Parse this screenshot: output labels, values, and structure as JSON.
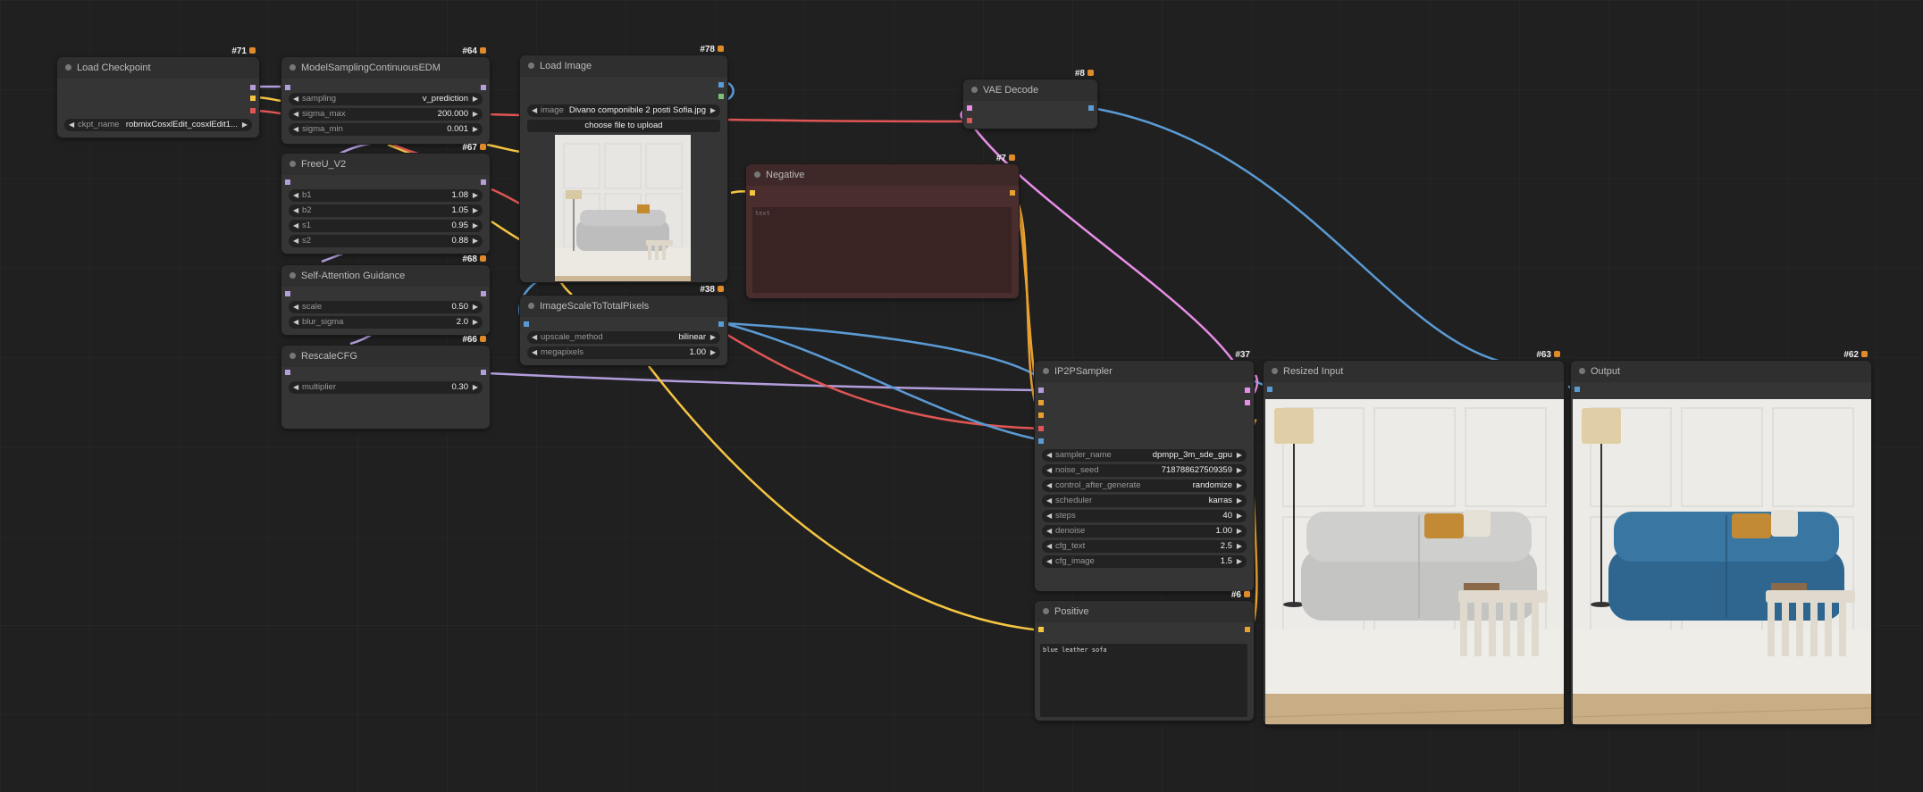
{
  "canvas": {
    "nodes": {
      "load_checkpoint": {
        "id": "#71",
        "title": "Load Checkpoint",
        "widgets": [
          {
            "label": "ckpt_name",
            "value": "robmixCosxlEdit_cosxlEdit1..."
          }
        ]
      },
      "model_sampling": {
        "id": "#64",
        "title": "ModelSamplingContinuousEDM",
        "widgets": [
          {
            "label": "sampling",
            "value": "v_prediction"
          },
          {
            "label": "sigma_max",
            "value": "200.000"
          },
          {
            "label": "sigma_min",
            "value": "0.001"
          }
        ]
      },
      "freeu": {
        "id": "#67",
        "title": "FreeU_V2",
        "widgets": [
          {
            "label": "b1",
            "value": "1.08"
          },
          {
            "label": "b2",
            "value": "1.05"
          },
          {
            "label": "s1",
            "value": "0.95"
          },
          {
            "label": "s2",
            "value": "0.88"
          }
        ]
      },
      "self_attention": {
        "id": "#68",
        "title": "Self-Attention Guidance",
        "widgets": [
          {
            "label": "scale",
            "value": "0.50"
          },
          {
            "label": "blur_sigma",
            "value": "2.0"
          }
        ]
      },
      "rescale_cfg": {
        "id": "#66",
        "title": "RescaleCFG",
        "widgets": [
          {
            "label": "multiplier",
            "value": "0.30"
          }
        ]
      },
      "load_image": {
        "id": "#78",
        "title": "Load Image",
        "widgets": [
          {
            "label": "image",
            "value": "Divano componibile 2 posti Sofia.jpg"
          }
        ],
        "upload_label": "choose file to upload"
      },
      "image_scale": {
        "id": "#38",
        "title": "ImageScaleToTotalPixels",
        "widgets": [
          {
            "label": "upscale_method",
            "value": "bilinear"
          },
          {
            "label": "megapixels",
            "value": "1.00"
          }
        ]
      },
      "negative": {
        "id": "#7",
        "title": "Negative",
        "text": "text"
      },
      "vae_decode": {
        "id": "#8",
        "title": "VAE Decode"
      },
      "ip2p_sampler": {
        "id": "#37",
        "title": "IP2PSampler",
        "widgets": [
          {
            "label": "sampler_name",
            "value": "dpmpp_3m_sde_gpu"
          },
          {
            "label": "noise_seed",
            "value": "718788627509359"
          },
          {
            "label": "control_after_generate",
            "value": "randomize"
          },
          {
            "label": "scheduler",
            "value": "karras"
          },
          {
            "label": "steps",
            "value": "40"
          },
          {
            "label": "denoise",
            "value": "1.00"
          },
          {
            "label": "cfg_text",
            "value": "2.5"
          },
          {
            "label": "cfg_image",
            "value": "1.5"
          }
        ]
      },
      "positive": {
        "id": "#6",
        "title": "Positive",
        "text": "blue leather sofa"
      },
      "resized_input": {
        "id": "#63",
        "title": "Resized Input"
      },
      "output": {
        "id": "#62",
        "title": "Output"
      }
    },
    "colors": {
      "model_link": "#b39ddb",
      "clip_link": "#f5c542",
      "vae_link": "#e05555",
      "image_link": "#5b9bd5",
      "latent_link": "#e88ee8",
      "conditioning_link": "#e8a030",
      "negative_node": "#4a2e2e"
    }
  }
}
